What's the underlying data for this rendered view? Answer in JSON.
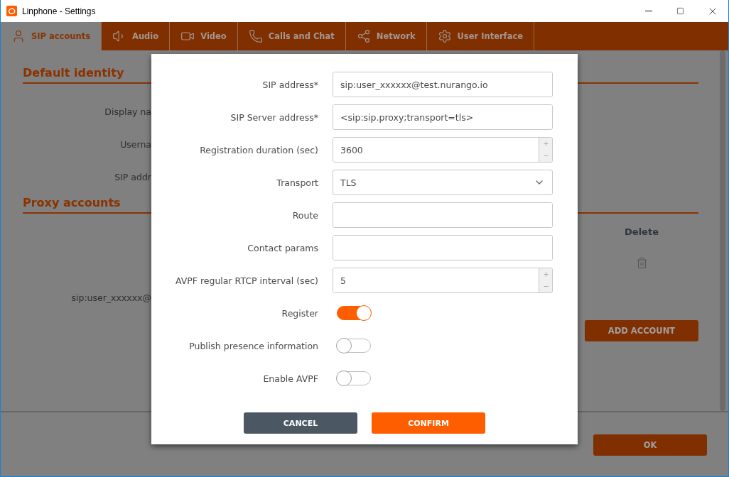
{
  "window": {
    "title": "Linphone - Settings"
  },
  "tabs": [
    {
      "label": "SIP accounts",
      "selected": true
    },
    {
      "label": "Audio",
      "selected": false
    },
    {
      "label": "Video",
      "selected": false
    },
    {
      "label": "Calls and Chat",
      "selected": false
    },
    {
      "label": "Network",
      "selected": false
    },
    {
      "label": "User Interface",
      "selected": false
    }
  ],
  "default_identity": {
    "heading": "Default identity",
    "labels": [
      "Display na",
      "Userna",
      "SIP addr"
    ]
  },
  "proxy_accounts": {
    "heading": "Proxy accounts",
    "delete_header": "Delete",
    "account": "sip:user_xxxxxx@",
    "add_button": "ADD ACCOUNT"
  },
  "ok_button": "OK",
  "dialog": {
    "fields": [
      {
        "label": "SIP address*",
        "kind": "text",
        "value": "sip:user_xxxxxx@test.nurango.io"
      },
      {
        "label": "SIP Server address*",
        "kind": "text",
        "value": "<sip:sip.proxy;transport=tls>"
      },
      {
        "label": "Registration duration (sec)",
        "kind": "spin",
        "value": "3600"
      },
      {
        "label": "Transport",
        "kind": "select",
        "value": "TLS"
      },
      {
        "label": "Route",
        "kind": "text"
      },
      {
        "label": "Contact params",
        "kind": "text"
      },
      {
        "label": "AVPF regular RTCP interval (sec)",
        "kind": "spin",
        "value": "5"
      },
      {
        "label": "Register",
        "kind": "toggle",
        "on": true
      },
      {
        "label": "Publish presence information",
        "kind": "toggle",
        "on": false
      },
      {
        "label": "Enable AVPF",
        "kind": "toggle",
        "on": false
      }
    ],
    "cancel_button": "CANCEL",
    "confirm_button": "CONFIRM"
  }
}
